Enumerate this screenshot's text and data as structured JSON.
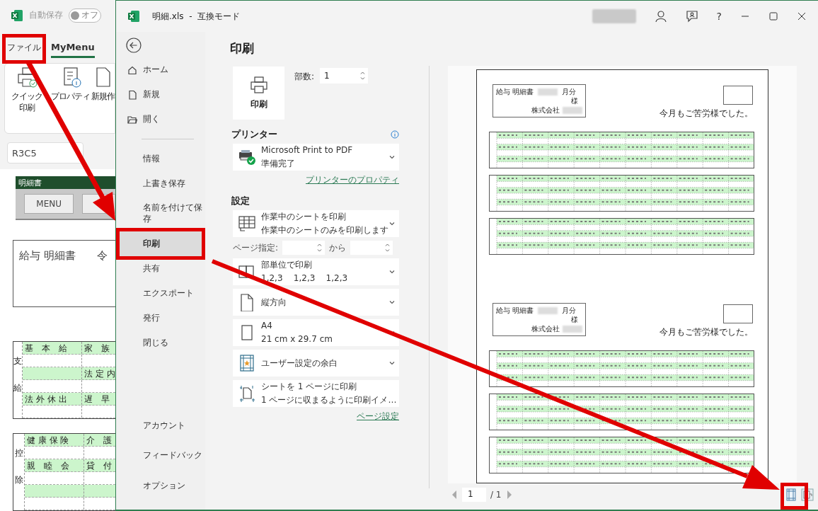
{
  "background_window": {
    "autosave": {
      "label": "自動保存",
      "toggle_text": "オフ",
      "on": false
    },
    "tabs": [
      {
        "label": "ファイル",
        "selected": false
      },
      {
        "label": "MyMenu",
        "selected": true
      }
    ],
    "ribbon_buttons": [
      {
        "lines": [
          "クイック",
          "印刷"
        ]
      },
      {
        "lines": [
          "プロパティ"
        ]
      },
      {
        "lines": [
          "新規作"
        ]
      }
    ],
    "name_box": "R3C5",
    "sheet": {
      "title_bar": "明細書",
      "buttons": [
        "MENU"
      ],
      "document_title": "給与 明細書",
      "document_title_cut": "令",
      "tables": [
        {
          "side_label": "支給",
          "rows": [
            {
              "shaded": true,
              "cells": [
                "基　本　給",
                "家　族"
              ]
            },
            {
              "shaded": false,
              "cells": []
            },
            {
              "shaded": true,
              "cells": [
                "",
                "法 定 内"
              ]
            },
            {
              "shaded": false,
              "cells": []
            },
            {
              "shaded": true,
              "cells": [
                "法 外 休 出",
                "遅　早"
              ]
            },
            {
              "shaded": false,
              "cells": []
            }
          ]
        },
        {
          "side_label": "控除",
          "rows": [
            {
              "shaded": true,
              "cells": [
                "健 康 保 険",
                "介　護"
              ]
            },
            {
              "shaded": false,
              "cells": []
            },
            {
              "shaded": true,
              "cells": [
                "親　睦　会",
                "貸　付"
              ]
            },
            {
              "shaded": false,
              "cells": []
            },
            {
              "shaded": true,
              "cells": []
            },
            {
              "shaded": false,
              "cells": []
            }
          ]
        }
      ]
    }
  },
  "window": {
    "title": "明細.xls  -  互換モード",
    "help": "?"
  },
  "nav": {
    "top": [
      {
        "label": "ホーム",
        "selected": false
      },
      {
        "label": "新規",
        "selected": false
      },
      {
        "label": "開く",
        "selected": false
      }
    ],
    "middle": [
      {
        "label": "情報",
        "selected": false
      },
      {
        "label": "上書き保存",
        "selected": false
      },
      {
        "label": "名前を付けて保存",
        "selected": false
      },
      {
        "label": "印刷",
        "selected": true
      },
      {
        "label": "共有",
        "selected": false
      },
      {
        "label": "エクスポート",
        "selected": false
      },
      {
        "label": "発行",
        "selected": false
      },
      {
        "label": "閉じる",
        "selected": false
      }
    ],
    "bottom": [
      {
        "label": "アカウント",
        "selected": false
      },
      {
        "label": "フィードバック",
        "selected": false
      },
      {
        "label": "オプション",
        "selected": false
      }
    ]
  },
  "print": {
    "heading": "印刷",
    "print_button": "印刷",
    "copies": {
      "label": "部数:",
      "value": "1"
    },
    "printer_heading": "プリンター",
    "printer": {
      "name": "Microsoft Print to PDF",
      "status": "準備完了"
    },
    "printer_properties_link": "プリンターのプロパティ",
    "settings_heading": "設定",
    "settings": [
      {
        "kind": "dropdown",
        "title": "作業中のシートを印刷",
        "detail": "作業中のシートのみを印刷します"
      },
      {
        "kind": "page_range",
        "label": "ページ指定:",
        "to_label": "から"
      },
      {
        "kind": "dropdown",
        "title": "部単位で印刷",
        "detail": "1,2,3    1,2,3    1,2,3"
      },
      {
        "kind": "dropdown",
        "title": "縦方向"
      },
      {
        "kind": "dropdown",
        "title": "A4",
        "detail": "21 cm x 29.7 cm"
      },
      {
        "kind": "dropdown",
        "title": "ユーザー設定の余白"
      },
      {
        "kind": "dropdown",
        "title": "シートを 1 ページに印刷",
        "detail": "1 ページに収まるように印刷イメ…"
      }
    ],
    "page_setup_link": "ページ設定"
  },
  "preview": {
    "slips": [
      {
        "title": "給与 明細書",
        "month_label": "月分",
        "honorific": "様",
        "company_label": "株式会社",
        "message": "今月もご苦労様でした。"
      },
      {
        "title": "給与 明細書",
        "month_label": "月分",
        "honorific": "様",
        "company_label": "株式会社",
        "message": "今月もご苦労様でした。"
      }
    ],
    "current_page": "1",
    "page_count": "/ 1"
  }
}
